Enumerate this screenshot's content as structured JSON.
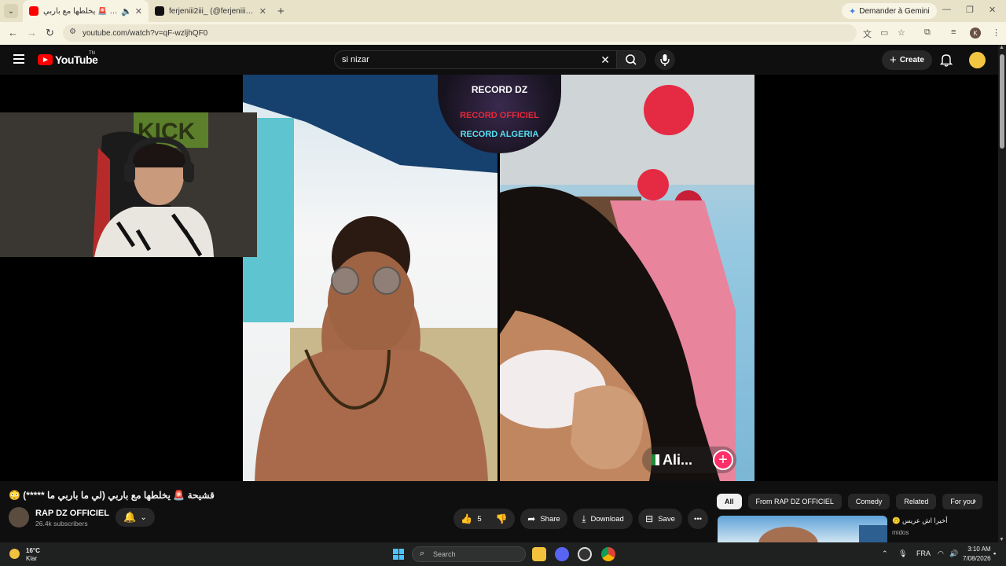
{
  "browser": {
    "tabs": [
      {
        "title": "قشيحة 🚨 يخلطها مع باربي (",
        "active": true
      },
      {
        "title": "ferjeniii2iii_ (@ferjeniii2iii_offic…",
        "active": false
      }
    ],
    "gemini_label": "Demander à Gemini",
    "url": "youtube.com/watch?v=qF-wzljhQF0",
    "profile_initial": "K"
  },
  "youtube": {
    "logo_text": "YouTube",
    "logo_tm": "TN",
    "search_value": "si nizar",
    "create_label": "Create"
  },
  "video": {
    "overlay_lines": [
      "RECORD DZ",
      "RECORD OFFICIEL",
      "RECORD ALGERIA"
    ],
    "live_tag": "Ali...",
    "title": "😳 قشيحة 🚨 يخلطها مع باربي (لي ما باربي ما *****)",
    "channel_name": "RAP DZ OFFICIEL",
    "subscribers": "26.4k subscribers",
    "like_count": "5",
    "share_label": "Share",
    "download_label": "Download",
    "save_label": "Save"
  },
  "sidebar": {
    "chips": [
      "All",
      "From RAP DZ OFFICIEL",
      "Comedy",
      "Related",
      "For you"
    ],
    "related": {
      "title": "أخيرا اش عريس 🙃",
      "channel": "midos"
    }
  },
  "taskbar": {
    "weather_temp": "16°C",
    "weather_desc": "Klar",
    "search_placeholder": "Search",
    "language": "FRA",
    "time": "3:10 AM",
    "date": "7/08/2026"
  },
  "colors": {
    "youtube_red": "#ff0000",
    "accent_blue": "#4cc2ff",
    "page_bg": "#0f0f0f"
  }
}
